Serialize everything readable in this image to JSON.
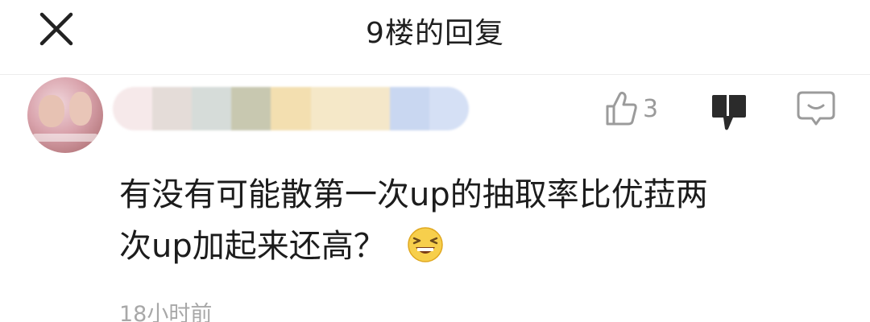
{
  "header": {
    "title": "9楼的回复"
  },
  "comment": {
    "username_blur_colors": [
      "#f6e9ea",
      "#e4dcd8",
      "#d6dcd9",
      "#c8c8b0",
      "#f3dfb0",
      "#f5e8c8",
      "#f4e7c9",
      "#c9d7f1",
      "#d5e0f5"
    ],
    "like_count": "3",
    "text_line1": "有没有可能散第一次up的抽取率比优菈两",
    "text_line2": "次up加起来还高？",
    "emoji": "grinning-squint-face",
    "time": "18小时前"
  },
  "colors": {
    "text": "#1c1c1c",
    "muted": "#9a9a9a",
    "icon": "#9b9b9b",
    "dislike_icon": "#2b2b2b"
  }
}
